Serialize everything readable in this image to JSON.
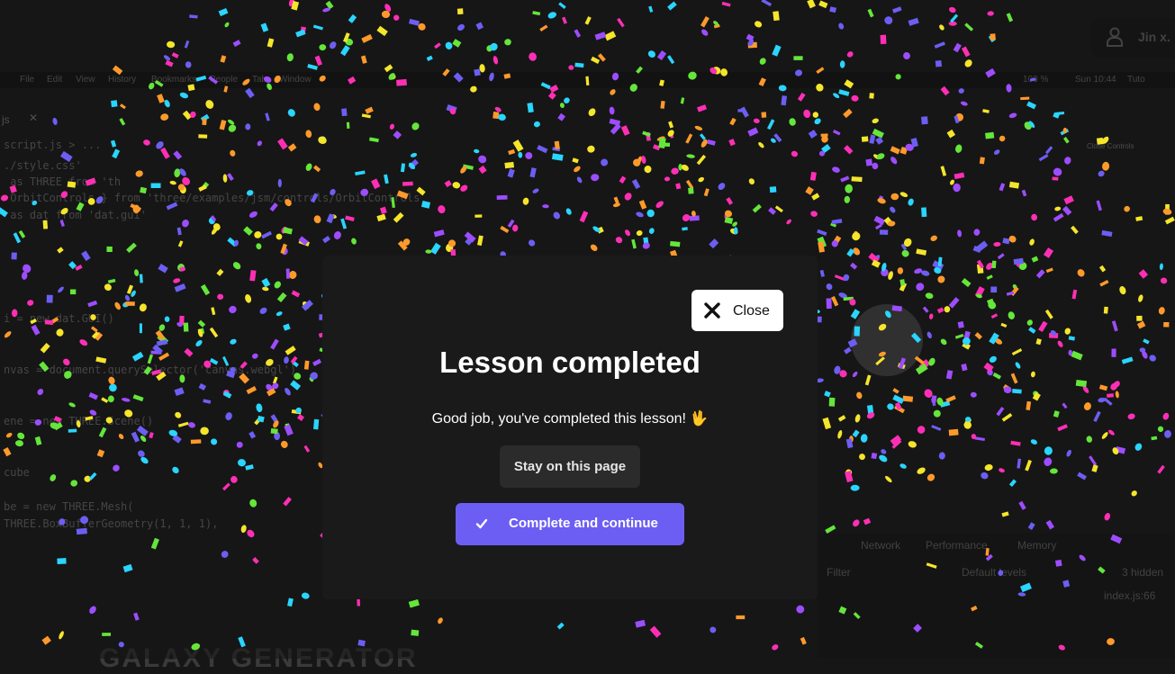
{
  "background": {
    "menu": [
      "File",
      "Edit",
      "View",
      "History",
      "Bookmarks",
      "People",
      "Tab",
      "Window"
    ],
    "status": [
      "100 %",
      "Sun 10:44",
      "Tuto"
    ],
    "editor_tab": "js",
    "code_lines": [
      "script.js > ...",
      "./style.css'",
      " as THREE from 'th",
      " OrbitControls } from 'three/examples/jsm/controls/OrbitControls",
      " as dat from 'dat.gui'",
      "i = new dat.GUI()",
      "nvas = document.querySelector('canvas.webgl')",
      "ene = new THREE.Scene()",
      "cube",
      "be = new THREE.Mesh(",
      "THREE.BoxBufferGeometry(1, 1, 1),"
    ],
    "user_name": "Jin x.",
    "close_controls": "Close Controls",
    "devtools": {
      "tabs": [
        "Network",
        "Performance",
        "Memory"
      ],
      "filter": "Filter",
      "levels": "Default levels",
      "hidden": "3 hidden",
      "source": "index.js:66"
    },
    "bottom_title": "GALAXY GENERATOR"
  },
  "modal": {
    "close_label": "Close",
    "title": "Lesson completed",
    "message": "Good job, you've completed this lesson! 🖖",
    "stay_label": "Stay on this page",
    "continue_label": "Complete and continue"
  },
  "colors": {
    "accent": "#6d5ef3",
    "modal_bg": "#1a1a1a",
    "confetti": [
      "#f5e52b",
      "#9d4dff",
      "#ff2fb5",
      "#2ad5ff",
      "#65e63a",
      "#ff9a2a",
      "#6d5ef3"
    ]
  },
  "icons": {
    "close": "x-icon",
    "continue": "check-icon",
    "user": "user-icon"
  }
}
